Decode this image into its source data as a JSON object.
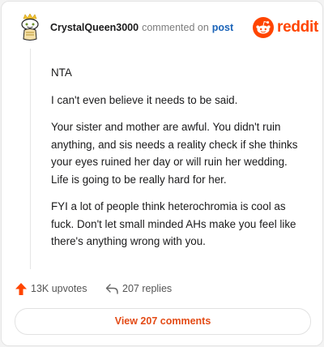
{
  "header": {
    "username": "CrystalQueen3000",
    "commented_on": "commented on",
    "post_link": "post",
    "brand_wordmark": "reddit",
    "brand_color": "#ff4500",
    "avatar_icon": "snoo-avatar-crown-icon"
  },
  "comment": {
    "paragraphs": [
      "NTA",
      "I can't even believe it needs to be said.",
      "Your sister and mother are awful. You didn't ruin anything, and sis needs a reality check if she thinks your eyes ruined her day or will ruin her wedding. Life is going to be really hard for her.",
      "FYI a lot of people think heterochromia is cool as fuck. Don't let small minded AHs make you feel like there's anything wrong with you."
    ]
  },
  "actions": {
    "upvotes_label": "13K upvotes",
    "replies_label": "207 replies",
    "upvote_icon": "upvote-arrow-icon",
    "reply_icon": "reply-arrow-icon"
  },
  "footer": {
    "view_comments_label": "View 207 comments",
    "accent_color": "#e34b16"
  }
}
